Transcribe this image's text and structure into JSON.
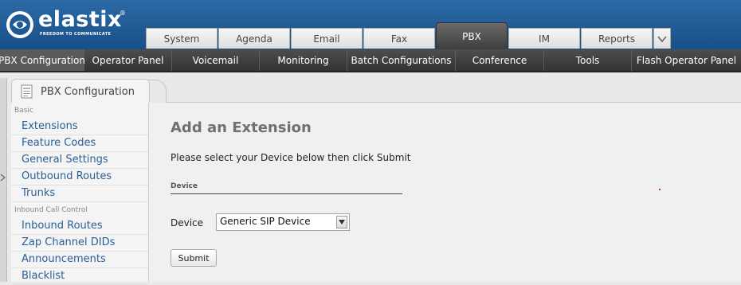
{
  "brand": {
    "name": "elastix",
    "registered": "®",
    "tagline": "FREEDOM TO COMMUNICATE"
  },
  "main_tabs": [
    {
      "label": "System"
    },
    {
      "label": "Agenda"
    },
    {
      "label": "Email"
    },
    {
      "label": "Fax"
    },
    {
      "label": "PBX",
      "active": true
    },
    {
      "label": "IM"
    },
    {
      "label": "Reports"
    }
  ],
  "tabs_more_icon": "chevron-down-icon",
  "sub_menu": [
    {
      "label": "PBX Configuration",
      "active": true
    },
    {
      "label": "Operator Panel"
    },
    {
      "label": "Voicemail"
    },
    {
      "label": "Monitoring"
    },
    {
      "label": "Batch Configurations"
    },
    {
      "label": "Conference"
    },
    {
      "label": "Tools"
    },
    {
      "label": "Flash Operator Panel"
    }
  ],
  "module": {
    "title": "PBX Configuration",
    "icon": "document-icon"
  },
  "side_menu": {
    "basic_header": "Basic",
    "basic_items": [
      "Extensions",
      "Feature Codes",
      "General Settings",
      "Outbound Routes",
      "Trunks"
    ],
    "inbound_header": "Inbound Call Control",
    "inbound_items": [
      "Inbound Routes",
      "Zap Channel DIDs",
      "Announcements",
      "Blacklist"
    ]
  },
  "content": {
    "title": "Add an Extension",
    "instruction": "Please select your Device below then click Submit",
    "section_label": "Device",
    "device_label": "Device",
    "device_selected": "Generic SIP Device",
    "submit_label": "Submit"
  },
  "colors": {
    "header_blue": "#1f5a96",
    "submenu_dark": "#3a3a3a",
    "link_blue": "#2a5f96"
  }
}
